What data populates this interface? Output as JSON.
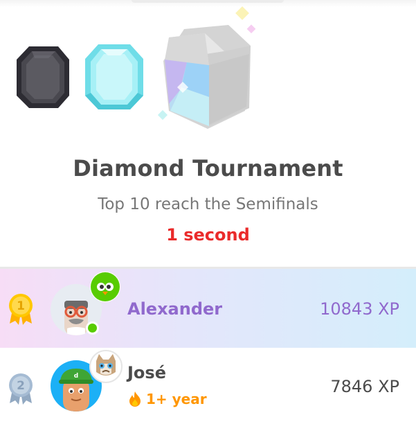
{
  "league": {
    "title": "Diamond Tournament",
    "subtitle": "Top 10 reach the Semifinals",
    "timer": "1 second",
    "badges": [
      "obsidian-league-icon",
      "diamond-league-icon",
      "tournament-league-icon"
    ]
  },
  "leaderboard": {
    "rows": [
      {
        "rank": "1",
        "name": "Alexander",
        "xp": "10843 XP",
        "highlighted": true,
        "online": true,
        "avatar": "glasses-person-avatar",
        "mini_avatar": "duo-owl-avatar"
      },
      {
        "rank": "2",
        "name": "José",
        "xp": "7846 XP",
        "highlighted": false,
        "streak": "1+ year",
        "avatar": "green-cap-person-avatar",
        "mini_avatar": "grumpy-cat-avatar"
      }
    ]
  },
  "colors": {
    "title": "#4b4b4b",
    "subtitle": "#777777",
    "timer": "#ea2b2b",
    "highlight_name": "#9069cd",
    "default_name": "#4b4b4b",
    "online": "#58cc02",
    "streak": "#ff9600",
    "gold_medal": "#ffc800",
    "silver_medal": "#a5bbd3"
  }
}
